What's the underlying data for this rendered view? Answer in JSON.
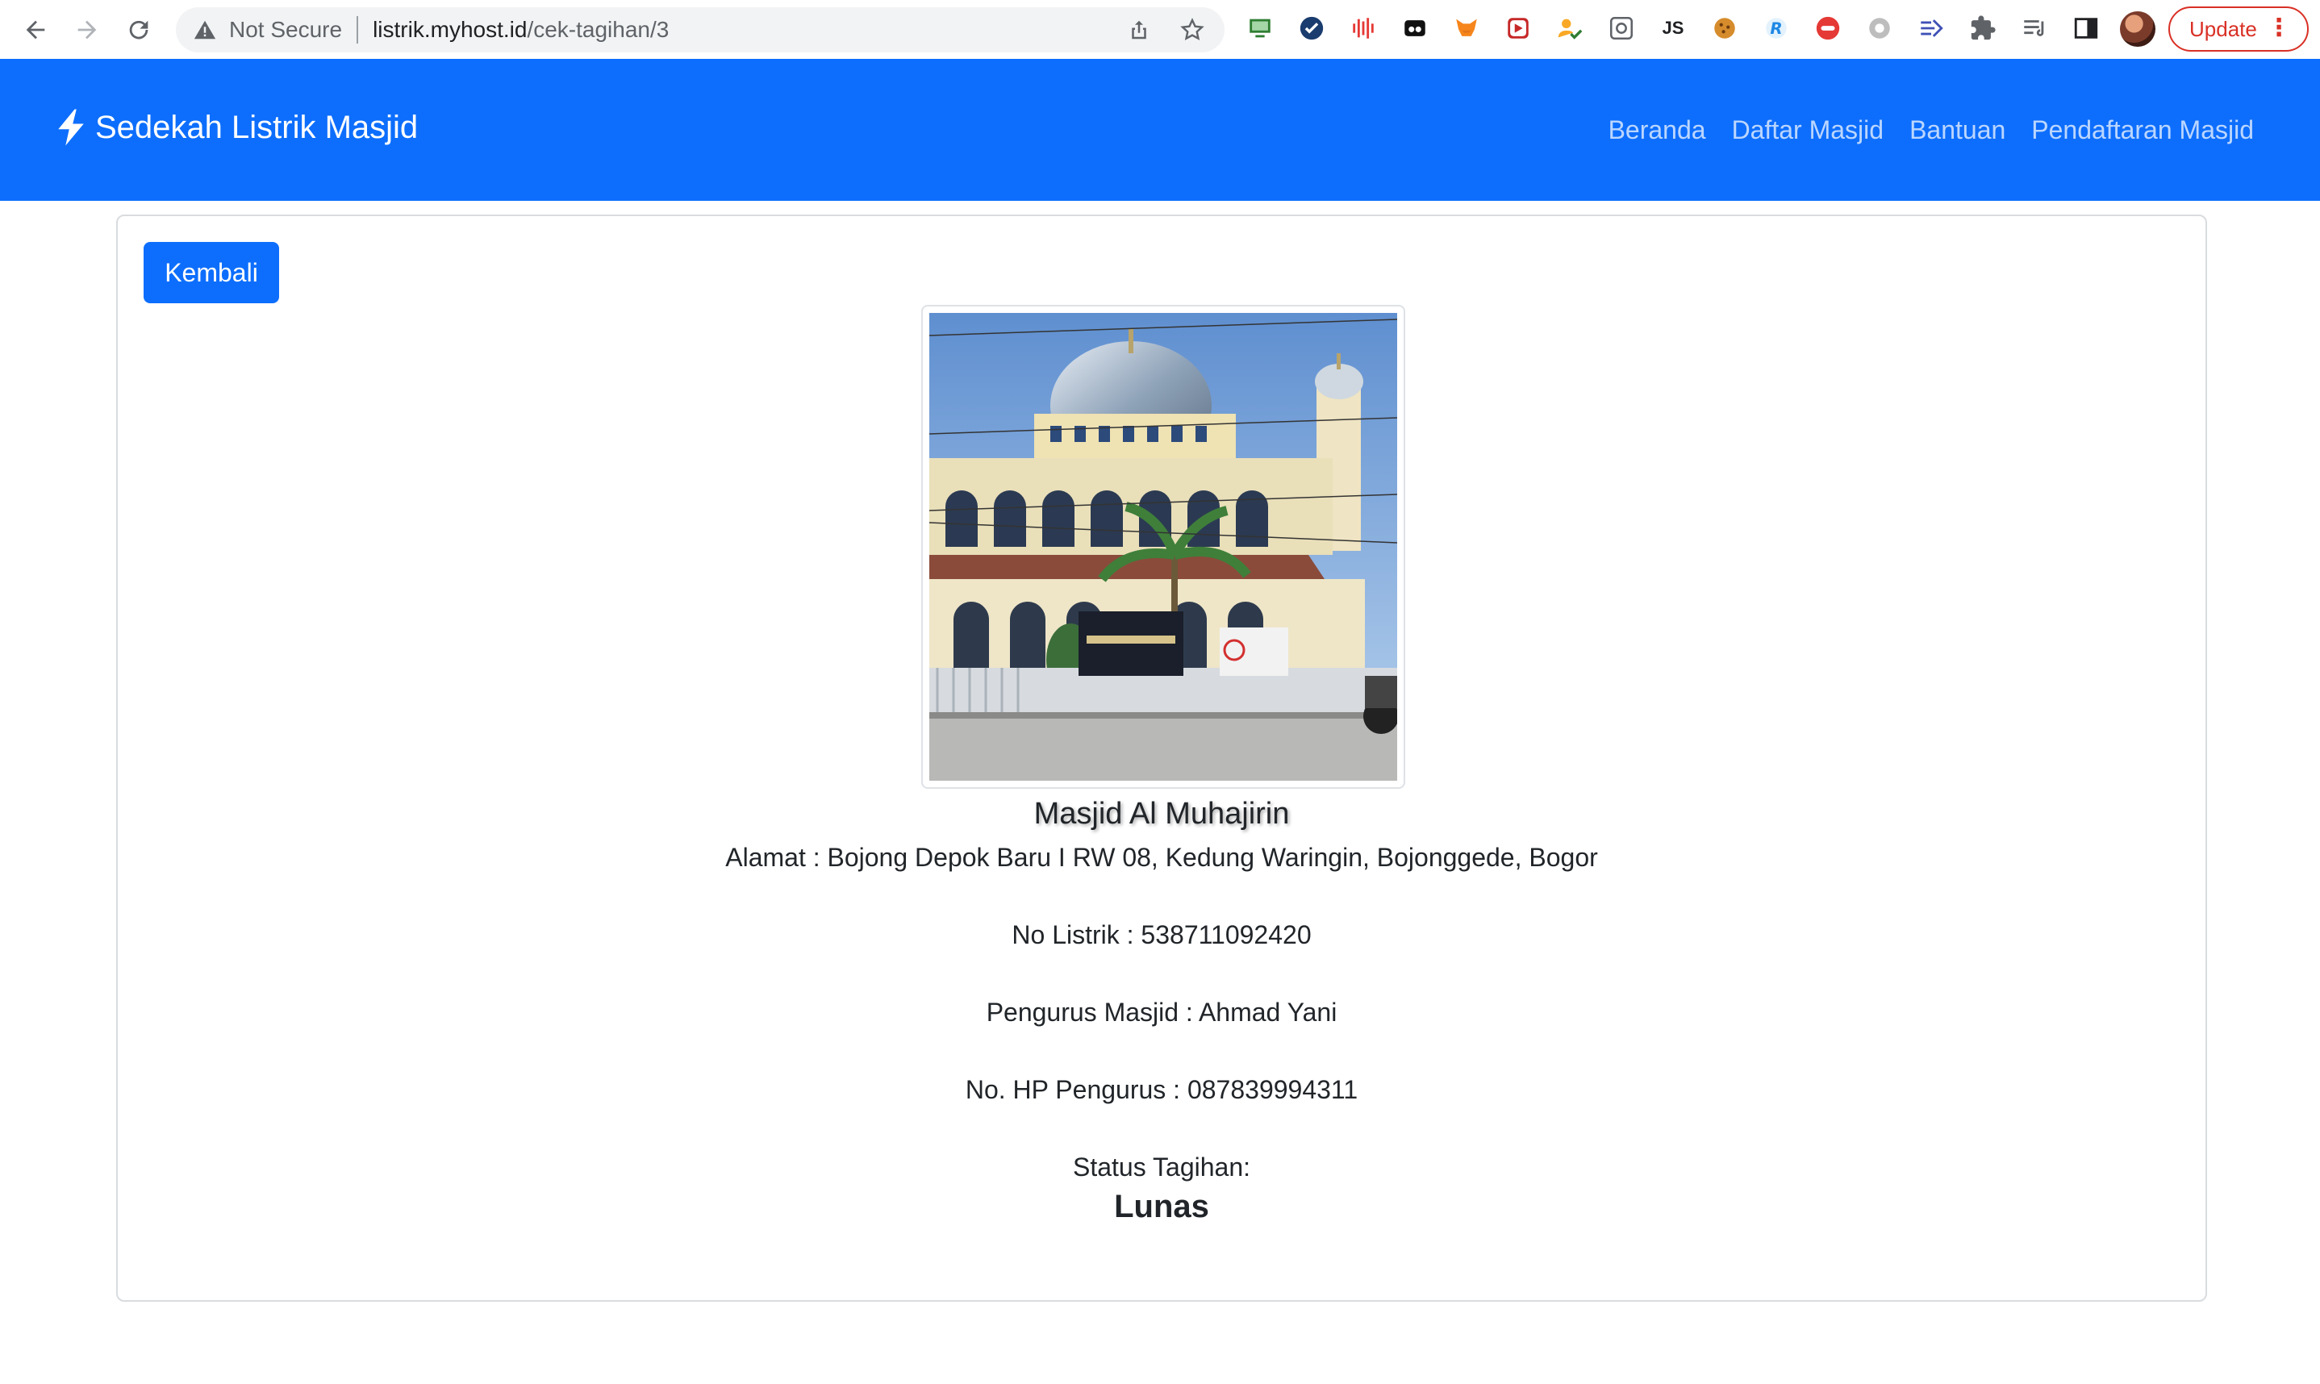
{
  "browser": {
    "security_label": "Not Secure",
    "url_host": "listrik.myhost.id",
    "url_path": "/cek-tagihan/3",
    "extensions": [
      {
        "name": "monitor-icon",
        "color": "#2e7d32"
      },
      {
        "name": "check-badge-icon",
        "color": "#1a3c6e"
      },
      {
        "name": "audio-bars-icon",
        "color": "#e53935"
      },
      {
        "name": "mask-icon",
        "color": "#111111"
      },
      {
        "name": "fox-icon",
        "color": "#f6851b"
      },
      {
        "name": "play-box-icon",
        "color": "#c62828"
      },
      {
        "name": "person-check-icon",
        "color": "#f9a825"
      },
      {
        "name": "camera-scan-icon",
        "color": "#5f6368"
      },
      {
        "name": "js-icon",
        "label": "JS",
        "color": "#202124"
      },
      {
        "name": "cookie-icon",
        "color": "#d68c2c"
      },
      {
        "name": "r-badge-icon",
        "color": "#1e88e5"
      },
      {
        "name": "red-circle-icon",
        "color": "#e53935"
      },
      {
        "name": "gear-globe-icon",
        "color": "#9e9e9e"
      },
      {
        "name": "arrow-lines-icon",
        "color": "#3f51b5"
      },
      {
        "name": "puzzle-icon",
        "color": "#5f6368"
      },
      {
        "name": "playlist-icon",
        "color": "#5f6368"
      },
      {
        "name": "sidepanel-icon",
        "color": "#202124"
      }
    ],
    "update_label": "Update"
  },
  "navbar": {
    "brand": "Sedekah Listrik Masjid",
    "links": [
      "Beranda",
      "Daftar Masjid",
      "Bantuan",
      "Pendaftaran Masjid"
    ],
    "color": "#0d6efd"
  },
  "card": {
    "back_button": "Kembali",
    "masjid_name": "Masjid Al Muhajirin",
    "address": "Alamat : Bojong Depok Baru I RW 08, Kedung Waringin, Bojonggede, Bogor",
    "no_listrik": "No Listrik : 538711092420",
    "pengurus": "Pengurus Masjid : Ahmad Yani",
    "hp_pengurus": "No. HP Pengurus : 087839994311",
    "status_label": "Status Tagihan:",
    "status_value": "Lunas"
  }
}
